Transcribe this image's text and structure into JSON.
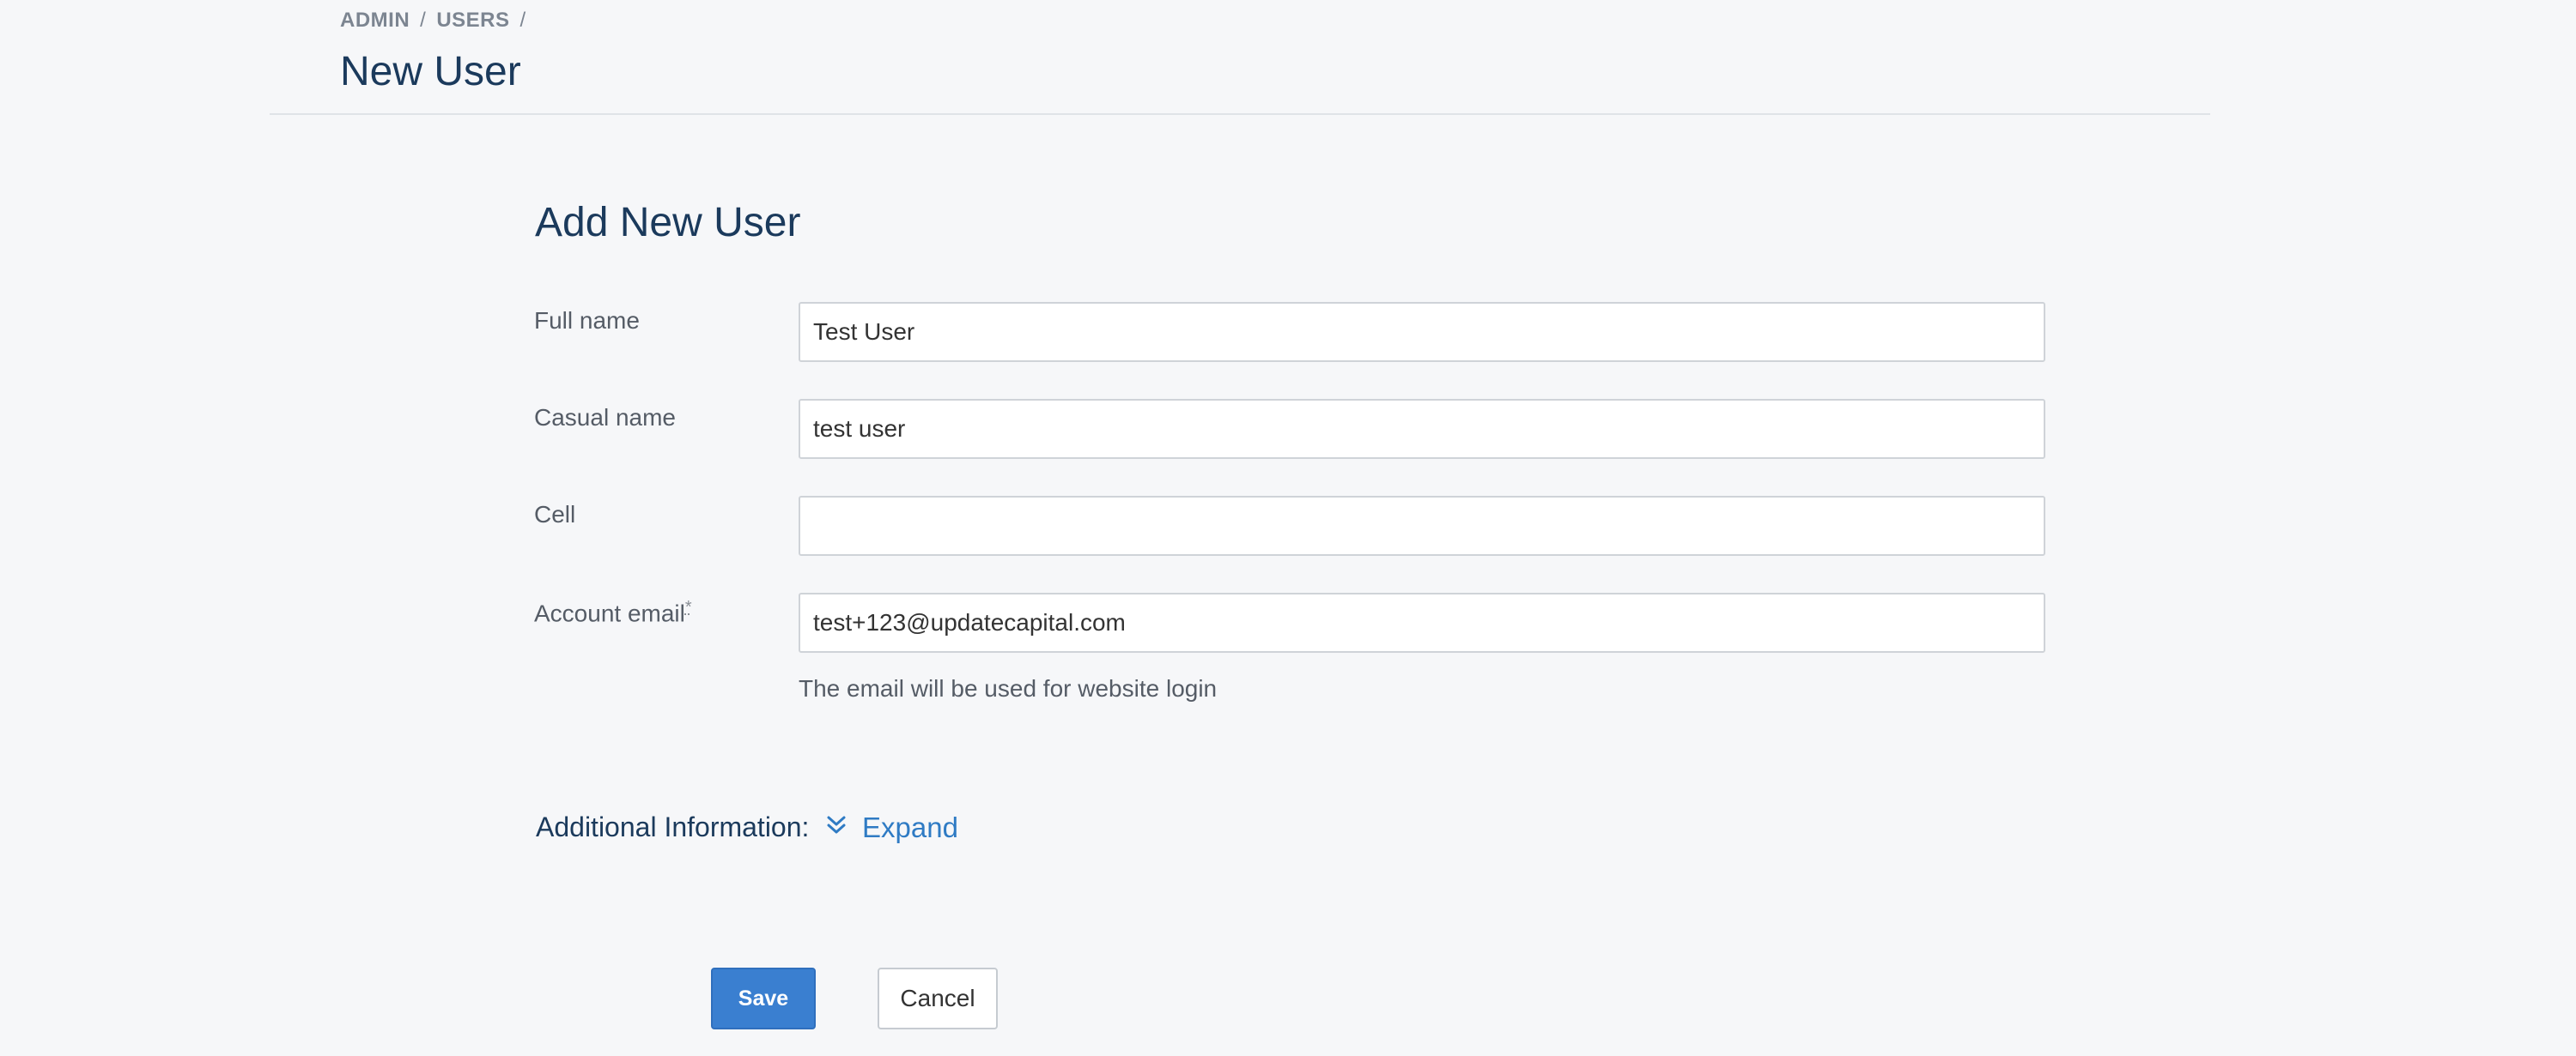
{
  "breadcrumb": {
    "items": [
      "ADMIN",
      "USERS"
    ],
    "separator": "/"
  },
  "header": {
    "title": "New User"
  },
  "form": {
    "title": "Add New User",
    "fields": [
      {
        "label": "Full name",
        "value": "Test User",
        "required": false
      },
      {
        "label": "Casual name",
        "value": "test user",
        "required": false
      },
      {
        "label": "Cell",
        "value": "",
        "required": false
      },
      {
        "label": "Account email",
        "value": "test+123@updatecapital.com",
        "required": true,
        "required_mark": "*"
      }
    ],
    "email_help": "The email will be used for website login"
  },
  "additional": {
    "label": "Additional Information:",
    "expand_label": "Expand",
    "icon": "double-chevron-down-icon"
  },
  "actions": {
    "save_label": "Save",
    "cancel_label": "Cancel"
  },
  "colors": {
    "background": "#f6f7f9",
    "title": "#1b3a5c",
    "link": "#2f7bc4",
    "primary_button": "#3a7fd0"
  }
}
